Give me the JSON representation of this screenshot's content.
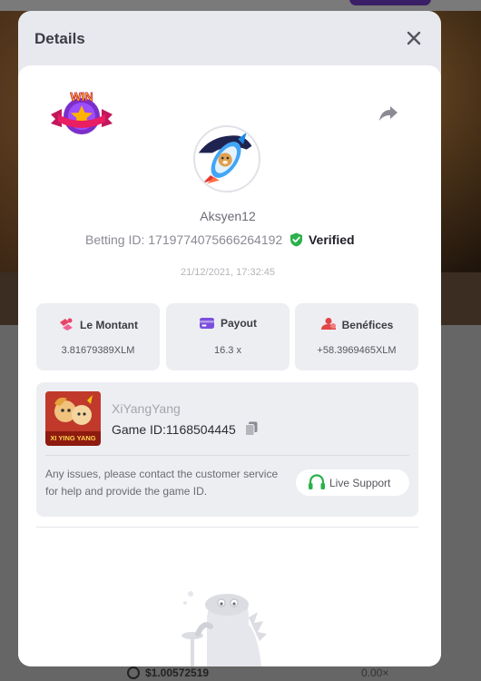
{
  "modal": {
    "title": "Details"
  },
  "bet": {
    "username": "Aksyen12",
    "betting_id_label": "Betting ID:",
    "betting_id": "1719774075666264192",
    "verified_label": "Verified",
    "timestamp": "21/12/2021, 17:32:45",
    "badge_text": "WIN"
  },
  "stats": [
    {
      "label": "Le Montant",
      "value": "3.81679389XLM",
      "icon": "coins-icon",
      "color": "#e8436a"
    },
    {
      "label": "Payout",
      "value": "16.3 x",
      "icon": "card-icon",
      "color": "#7b4ee0"
    },
    {
      "label": "Benéfices",
      "value": "+58.3969465XLM",
      "icon": "profit-icon",
      "color": "#e04646"
    }
  ],
  "game": {
    "name": "XiYangYang",
    "game_id_label": "Game ID:",
    "game_id": "1168504445",
    "thumb_caption": "XI YING YANG",
    "issues_text": "Any issues, please contact the customer service for help and provide the game ID.",
    "support_label": "Live Support"
  },
  "background": {
    "balance": "$1.00572519",
    "multiplier": "0.00×"
  },
  "colors": {
    "verified": "#2bb14c",
    "support_icon": "#2bb14c",
    "accent": "#7b4ee0"
  }
}
